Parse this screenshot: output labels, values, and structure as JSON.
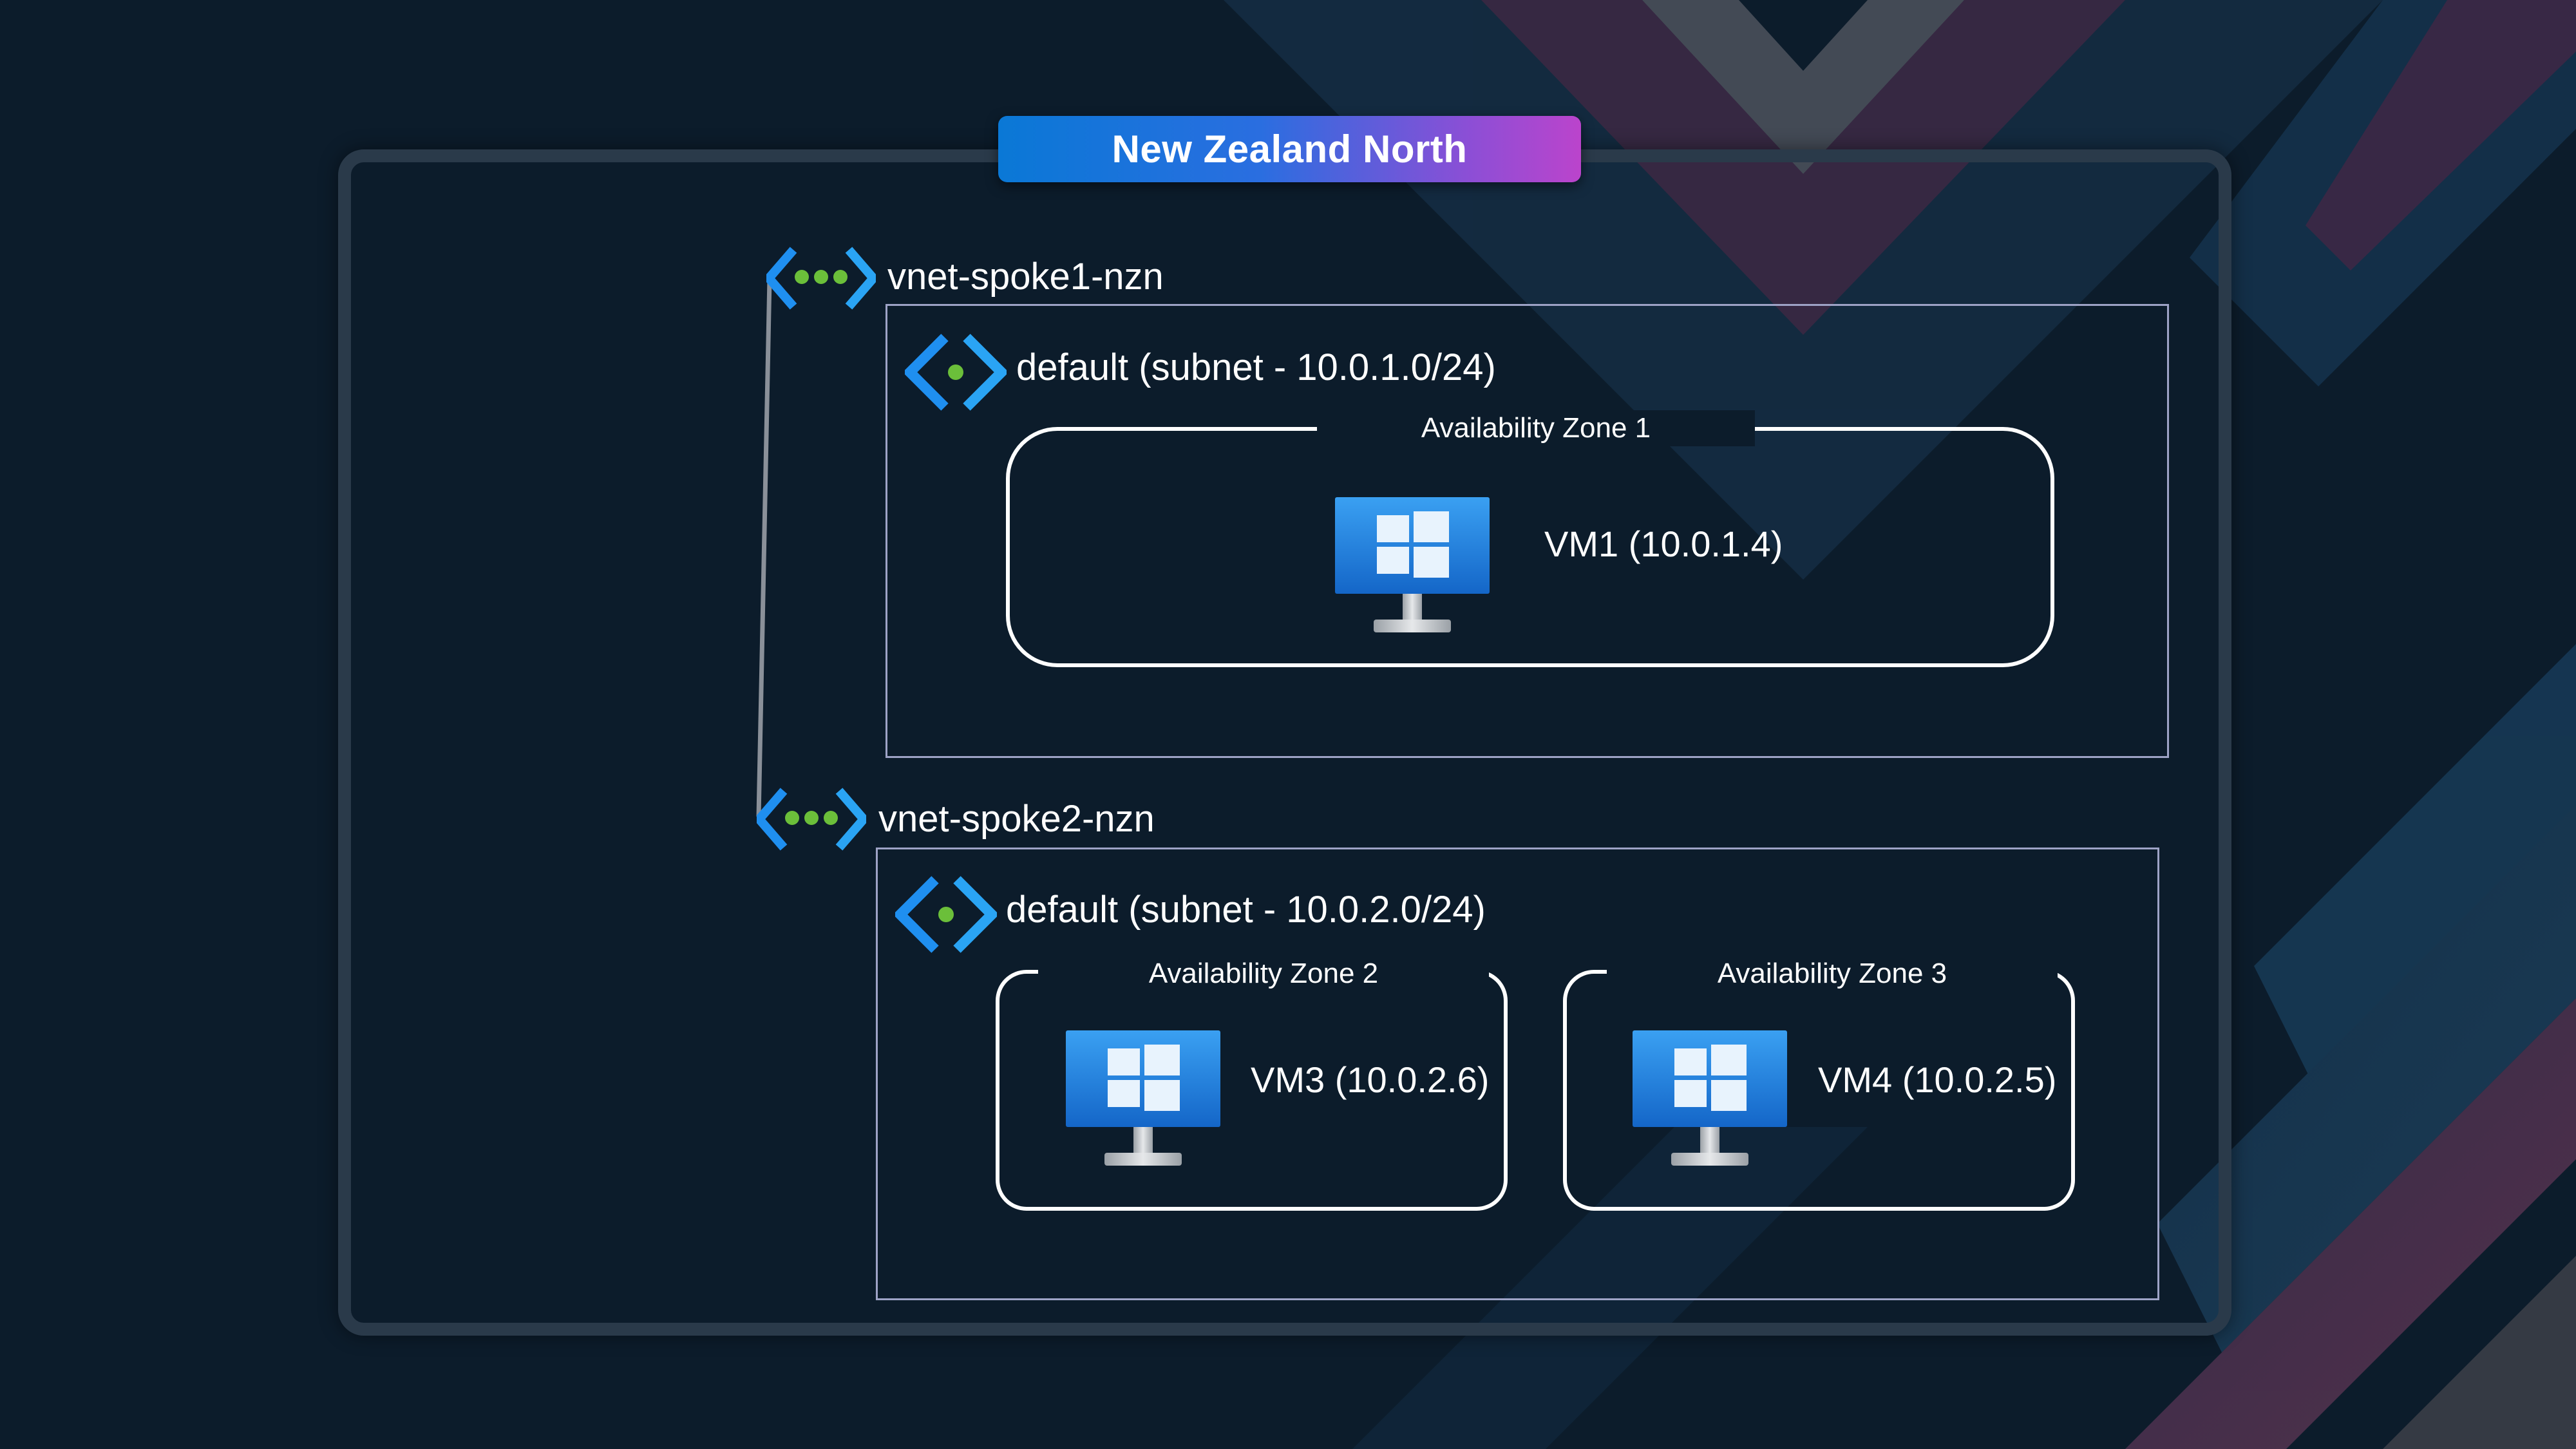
{
  "colors": {
    "background": "#0c1c2b",
    "region_frame": "#2a3a4a",
    "subnet_border": "#9ea3c6",
    "zone_border": "#ffffff",
    "accent_blue": "#1f8ff0",
    "accent_green": "#6bbf3a"
  },
  "region": {
    "name": "New Zealand North"
  },
  "vnets": [
    {
      "name": "vnet-spoke1-nzn",
      "icon": "virtual-network-icon",
      "subnet": {
        "label": "default (subnet - 10.0.1.0/24)",
        "icon": "subnet-icon",
        "zones": [
          {
            "title": "Availability Zone 1",
            "vms": [
              {
                "label": "VM1 (10.0.1.4)",
                "icon": "windows-vm-icon"
              }
            ]
          }
        ]
      }
    },
    {
      "name": "vnet-spoke2-nzn",
      "icon": "virtual-network-icon",
      "subnet": {
        "label": "default (subnet - 10.0.2.0/24)",
        "icon": "subnet-icon",
        "zones": [
          {
            "title": "Availability Zone 2",
            "vms": [
              {
                "label": "VM3 (10.0.2.6)",
                "icon": "windows-vm-icon"
              }
            ]
          },
          {
            "title": "Availability Zone 3",
            "vms": [
              {
                "label": "VM4 (10.0.2.5)",
                "icon": "windows-vm-icon"
              }
            ]
          }
        ]
      }
    }
  ]
}
